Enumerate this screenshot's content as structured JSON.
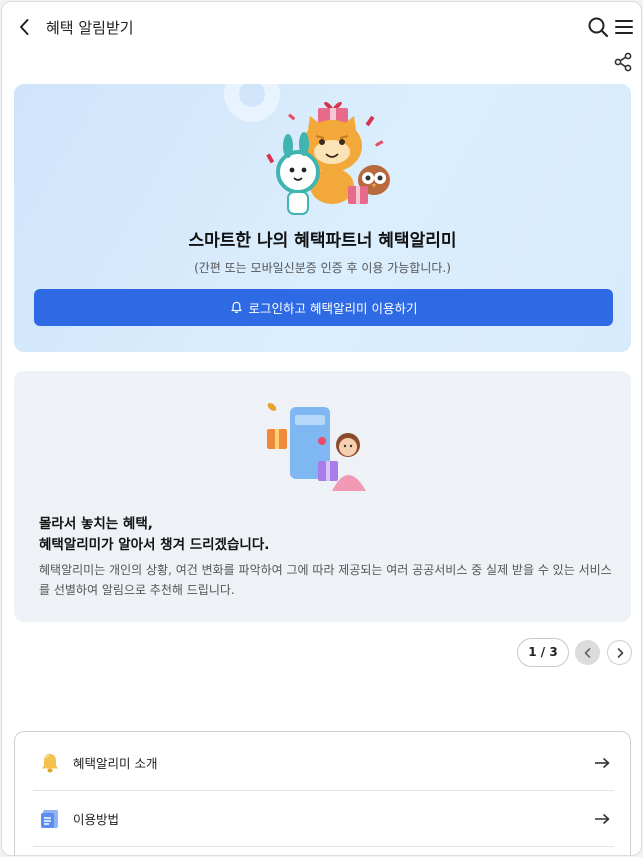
{
  "header": {
    "title": "혜택 알림받기",
    "back_icon": "chevron-left-icon",
    "search_icon": "search-icon",
    "menu_icon": "hamburger-menu-icon",
    "share_icon": "share-icon"
  },
  "hero": {
    "title": "스마트한 나의 혜택파트너 혜택알리미",
    "subtitle": "(간편 또는 모바일신분증 인증 후 이용 가능합니다.)",
    "login_button": "로그인하고 혜택알리미 이용하기",
    "button_icon": "bell-icon",
    "accent_color": "#2f6ae5"
  },
  "slide": {
    "heading_line1": "몰라서 놓치는 혜택,",
    "heading_line2": "혜택알리미가 알아서 챙겨 드리겠습니다.",
    "description": "혜택알리미는 개인의 상황, 여건 변화를 파악하여 그에 따라 제공되는 여러 공공서비스 중 실제 받을 수 있는 서비스를 선별하여 알림으로 추천해 드립니다."
  },
  "pager": {
    "current": 1,
    "total": 3,
    "label": "1 / 3",
    "prev_icon": "chevron-left-icon",
    "next_icon": "chevron-right-icon"
  },
  "links": [
    {
      "label": "혜택알리미 소개",
      "icon": "bell-icon",
      "arrow": "arrow-right-icon"
    },
    {
      "label": "이용방법",
      "icon": "document-icon",
      "arrow": "arrow-right-icon"
    }
  ]
}
